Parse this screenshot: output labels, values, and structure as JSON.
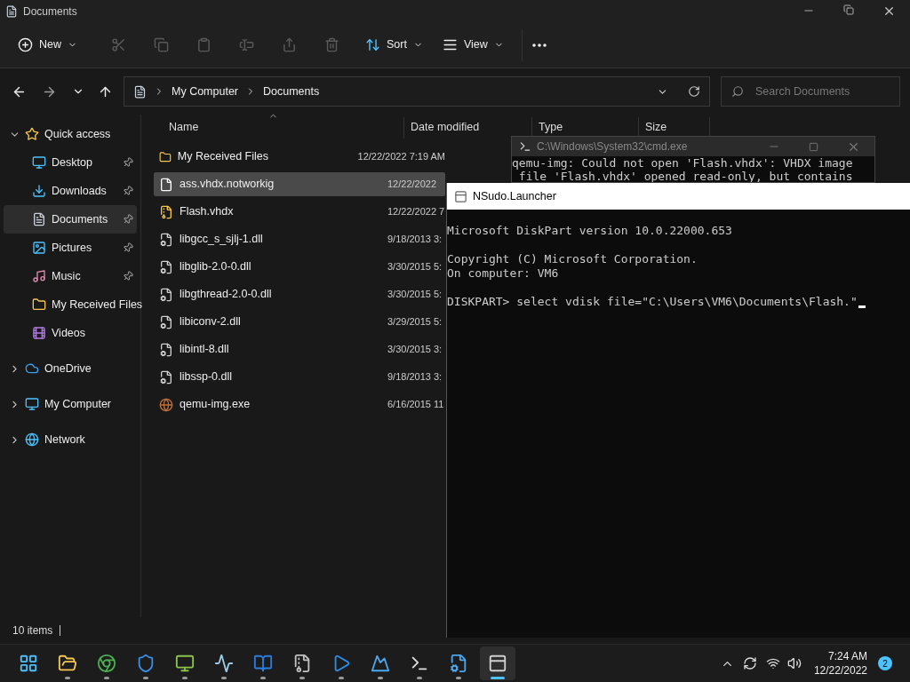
{
  "window": {
    "title": "Documents"
  },
  "toolbar": [
    {
      "kind": "menu",
      "label": "New",
      "disabled": false
    },
    {
      "kind": "icon",
      "disabled": true
    },
    {
      "kind": "icon",
      "disabled": true
    },
    {
      "kind": "icon",
      "disabled": true
    },
    {
      "kind": "icon",
      "disabled": true
    },
    {
      "kind": "icon",
      "disabled": true
    },
    {
      "kind": "icon",
      "disabled": true
    },
    {
      "kind": "menu",
      "label": "Sort",
      "disabled": false
    },
    {
      "kind": "menu",
      "label": "View",
      "disabled": false
    },
    {
      "kind": "more",
      "disabled": false
    }
  ],
  "address": {
    "crumbs": [
      "My Computer",
      "Documents"
    ]
  },
  "search": {
    "placeholder": "Search Documents"
  },
  "nav": [
    {
      "label": "Quick access",
      "kind": "star",
      "expanded": true,
      "selected": false,
      "children": [
        {
          "label": "Desktop",
          "kind": "desktop",
          "pinned": true,
          "selected": false
        },
        {
          "label": "Downloads",
          "kind": "downloads",
          "pinned": true,
          "selected": false
        },
        {
          "label": "Documents",
          "kind": "documents",
          "pinned": true,
          "selected": true
        },
        {
          "label": "Pictures",
          "kind": "pictures",
          "pinned": true,
          "selected": false
        },
        {
          "label": "Music",
          "kind": "music",
          "pinned": true,
          "selected": false
        },
        {
          "label": "My Received Files",
          "kind": "folder",
          "pinned": false,
          "selected": false
        },
        {
          "label": "Videos",
          "kind": "videos",
          "pinned": false,
          "selected": false
        }
      ]
    },
    {
      "label": "OneDrive",
      "kind": "cloud",
      "expanded": false,
      "selected": false
    },
    {
      "label": "My Computer",
      "kind": "computer",
      "expanded": false,
      "selected": false
    },
    {
      "label": "Network",
      "kind": "network",
      "expanded": false,
      "selected": false
    }
  ],
  "columns": [
    "Name",
    "Date modified",
    "Type",
    "Size"
  ],
  "files": [
    {
      "name": "My Received Files",
      "date": "12/22/2022 7:19 AM",
      "kind": "folder",
      "selected": false
    },
    {
      "name": "ass.vhdx.notworkig",
      "date": "12/22/2022",
      "kind": "file",
      "selected": true
    },
    {
      "name": "Flash.vhdx",
      "date": "12/22/2022 7",
      "kind": "vhdx",
      "selected": false
    },
    {
      "name": "libgcc_s_sjlj-1.dll",
      "date": "9/18/2013 3:",
      "kind": "dll",
      "selected": false
    },
    {
      "name": "libglib-2.0-0.dll",
      "date": "3/30/2015 5:",
      "kind": "dll",
      "selected": false
    },
    {
      "name": "libgthread-2.0-0.dll",
      "date": "3/30/2015 5:",
      "kind": "dll",
      "selected": false
    },
    {
      "name": "libiconv-2.dll",
      "date": "3/29/2015 5:",
      "kind": "dll",
      "selected": false
    },
    {
      "name": "libintl-8.dll",
      "date": "3/30/2015 3:",
      "kind": "dll",
      "selected": false
    },
    {
      "name": "libssp-0.dll",
      "date": "9/18/2013 3:",
      "kind": "dll",
      "selected": false
    },
    {
      "name": "qemu-img.exe",
      "date": "6/16/2015 11",
      "kind": "exe",
      "selected": false
    }
  ],
  "status_bar": {
    "items": "10 items"
  },
  "cmd_window": {
    "title": "C:\\Windows\\System32\\cmd.exe",
    "lines": [
      "qemu-img: Could not open 'Flash.vhdx': VHDX image",
      " file 'Flash.vhdx' opened read-only, but contains"
    ]
  },
  "nsudo_window": {
    "title": "NSudo.Launcher",
    "blocks": [
      [
        "Microsoft DiskPart version 10.0.22000.653"
      ],
      [
        "Copyright (C) Microsoft Corporation.",
        "On computer: VM6"
      ],
      [
        "DISKPART> select vdisk file=\"C:\\Users\\VM6\\Documents\\Flash.\""
      ]
    ]
  },
  "taskbar": {
    "apps": [
      {
        "active": false,
        "running": false
      },
      {
        "active": false,
        "running": true
      },
      {
        "active": false,
        "running": true
      },
      {
        "active": false,
        "running": true
      },
      {
        "active": false,
        "running": true
      },
      {
        "active": false,
        "running": true
      },
      {
        "active": false,
        "running": true
      },
      {
        "active": false,
        "running": true
      },
      {
        "active": false,
        "running": true
      },
      {
        "active": false,
        "running": true
      },
      {
        "active": false,
        "running": true
      },
      {
        "active": false,
        "running": true
      },
      {
        "active": true,
        "running": true
      }
    ],
    "time": "7:24 AM",
    "date": "12/22/2022",
    "notifications": "2"
  }
}
